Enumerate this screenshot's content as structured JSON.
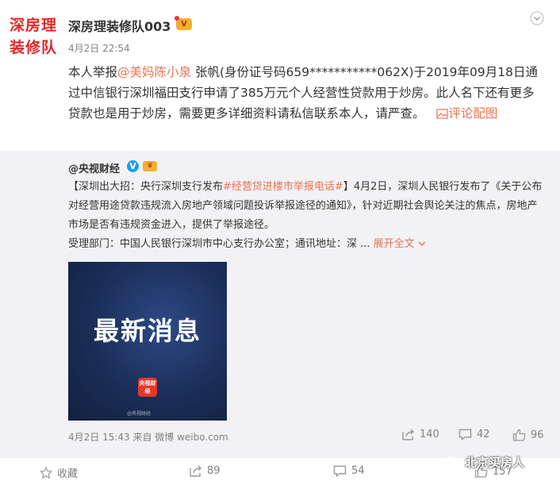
{
  "post": {
    "avatar_line1": "深房理",
    "avatar_line2": "装修队",
    "username": "深房理装修队003",
    "vip_badge": "V",
    "time": "4月2日 22:54",
    "text_prefix": "本人举报",
    "mention": "@美妈陈小泉",
    "text_main": " 张帆(身份证号码659***********062X)于2019年09月18日通过中信银行深圳福田支行申请了385万元个人经营性贷款用于炒房。此人名下还有更多贷款也是用于炒房，需要更多详细资料请私信联系本人，请严查。",
    "pic_link": "评论配图"
  },
  "repost": {
    "author": "@央视财经",
    "verified": "V",
    "text_bracket": "【深圳出大招：央行深圳支行发布",
    "hashtag": "#经营贷进楼市举报电话#",
    "text_body": "】4月2日，深圳人民银行发布了《关于公布对经营用途贷款违规流入房地产领域问题投诉举报途径的通知》，针对近期社会舆论关注的焦点，房地产市场是否有违规资金进入，提供了举报途径。",
    "text_dept": "受理部门：中国人民银行深圳市中心支行办公室；通讯地址：深 ... ",
    "expand": "展开全文",
    "image_title": "最新消息",
    "image_logo": "央视财经",
    "image_watermark": "@央视财经",
    "meta": "4月2日 15:43 来自 微博 weibo.com",
    "stats": {
      "share": "140",
      "comment": "42",
      "like": "96"
    }
  },
  "actions": {
    "favorite": "收藏",
    "share": "89",
    "comment": "54",
    "like": "157"
  },
  "watermark": "北京买房人",
  "colors": {
    "accent": "#eb7350",
    "avatar_red": "#e02828",
    "verified_blue": "#1e9cf0"
  }
}
